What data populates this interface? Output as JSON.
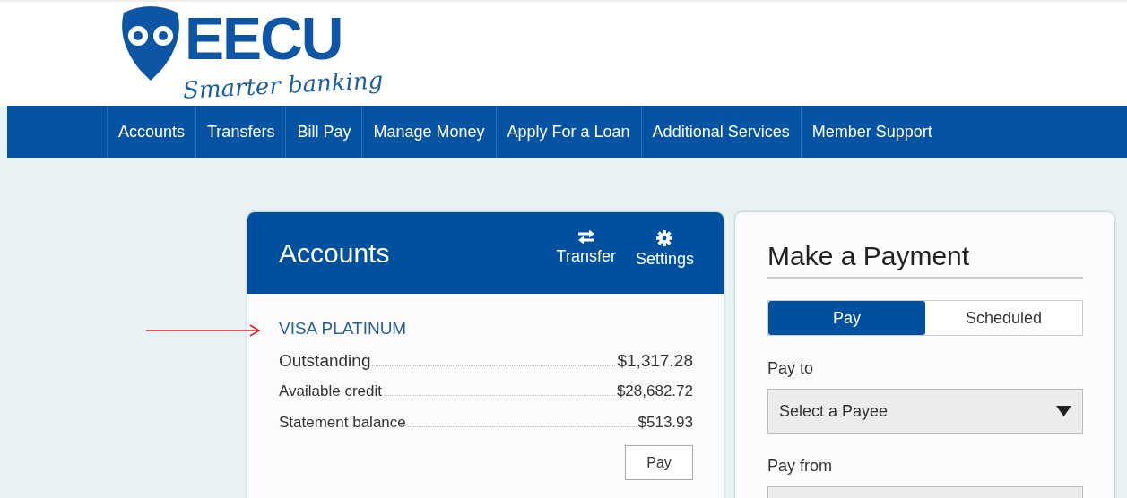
{
  "logo": {
    "name": "EECU",
    "tagline": "Smarter banking"
  },
  "nav": [
    {
      "label": "Accounts"
    },
    {
      "label": "Transfers"
    },
    {
      "label": "Bill Pay"
    },
    {
      "label": "Manage Money"
    },
    {
      "label": "Apply For a Loan"
    },
    {
      "label": "Additional Services"
    },
    {
      "label": "Member Support"
    }
  ],
  "accounts": {
    "title": "Accounts",
    "actions": [
      {
        "label": "Transfer",
        "kind": "transfer"
      },
      {
        "label": "Settings",
        "kind": "settings"
      }
    ],
    "account": {
      "name": "VISA PLATINUM",
      "rows": [
        {
          "label": "Outstanding",
          "value": "$1,317.28",
          "kind": "primary"
        },
        {
          "label": "Available credit",
          "value": "$28,682.72",
          "kind": "secondary"
        },
        {
          "label": "Statement balance",
          "value": "$513.93",
          "kind": "secondary"
        }
      ],
      "button": "Pay"
    }
  },
  "payment": {
    "title": "Make a Payment",
    "tabs": [
      {
        "label": "Pay",
        "selected": true
      },
      {
        "label": "Scheduled",
        "selected": false
      }
    ],
    "fields": [
      {
        "label": "Pay to",
        "value": "Select a Payee"
      },
      {
        "label": "Pay from"
      }
    ]
  }
}
